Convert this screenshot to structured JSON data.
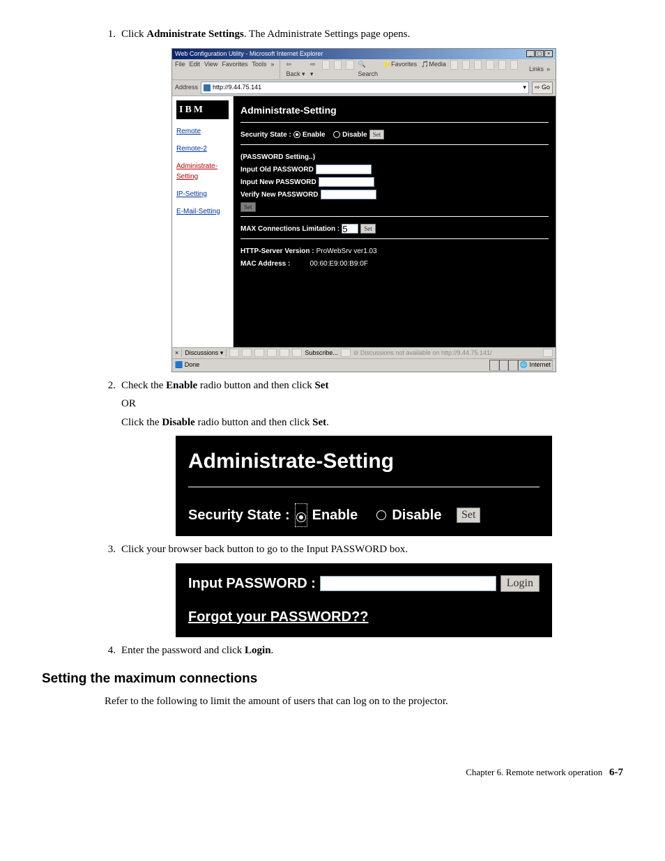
{
  "steps": {
    "s1": {
      "num": "1.",
      "prefix": "Click ",
      "bold": "Administrate Settings",
      "suffix": ". The Administrate Settings page opens."
    },
    "s2": {
      "num": "2.",
      "prefix": "Check the ",
      "bold": "Enable",
      "mid": " radio button and then click ",
      "bold2": "Set",
      "or": "OR",
      "line2_prefix": "Click the ",
      "line2_bold": "Disable",
      "line2_mid": " radio button and then click ",
      "line2_bold2": "Set",
      "line2_suffix": "."
    },
    "s3": {
      "num": "3.",
      "text": "Click your browser back button to go to the Input PASSWORD box."
    },
    "s4": {
      "num": "4.",
      "prefix": "Enter the password and click ",
      "bold": "Login",
      "suffix": "."
    }
  },
  "browser": {
    "title": "Web Configuration Utility - Microsoft Internet Explorer",
    "menu": [
      "File",
      "Edit",
      "View",
      "Favorites",
      "Tools"
    ],
    "toolbar": {
      "back": "Back",
      "search": "Search",
      "favorites": "Favorites",
      "media": "Media"
    },
    "address_label": "Address",
    "url": "http://9.44.75.141",
    "go": "Go",
    "links": "Links",
    "sidebar": {
      "logo": "IBM",
      "items": [
        {
          "label": "Remote",
          "active": false
        },
        {
          "label": "Remote-2",
          "active": false
        },
        {
          "label": "Administrate-Setting",
          "active": true
        },
        {
          "label": "IP-Setting",
          "active": false
        },
        {
          "label": "E-Mail-Setting",
          "active": false
        }
      ]
    },
    "main": {
      "heading": "Administrate-Setting",
      "security_label": "Security State :",
      "enable": "Enable",
      "disable": "Disable",
      "set": "Set",
      "pw_heading": "(PASSWORD Setting..)",
      "old_pw": "Input Old PASSWORD",
      "new_pw": "Input New PASSWORD",
      "verify_pw": "Verify New PASSWORD",
      "max_conn": "MAX Connections Limitation :",
      "max_conn_val": "5",
      "http_label": "HTTP-Server Version :",
      "http_val": "ProWebSrv ver1.03",
      "mac_label": "MAC Address :",
      "mac_val": "00:60:E9:00:B9:0F"
    },
    "status": {
      "discussions": "Discussions",
      "subscribe": "Subscribe...",
      "not_available": "Discussions not available on http://9.44.75.141/",
      "done": "Done",
      "internet": "Internet"
    }
  },
  "closeup1": {
    "heading": "Administrate-Setting",
    "security_label": "Security State :",
    "enable": "Enable",
    "disable": "Disable",
    "set": "Set"
  },
  "closeup2": {
    "label": "Input PASSWORD :",
    "login": "Login",
    "forgot": "Forgot your PASSWORD??"
  },
  "section": {
    "heading": "Setting the maximum connections",
    "body": "Refer to the following to limit the amount of users that can log on to the projector."
  },
  "footer": {
    "chapter": "Chapter 6. Remote network operation",
    "page": "6-7"
  }
}
